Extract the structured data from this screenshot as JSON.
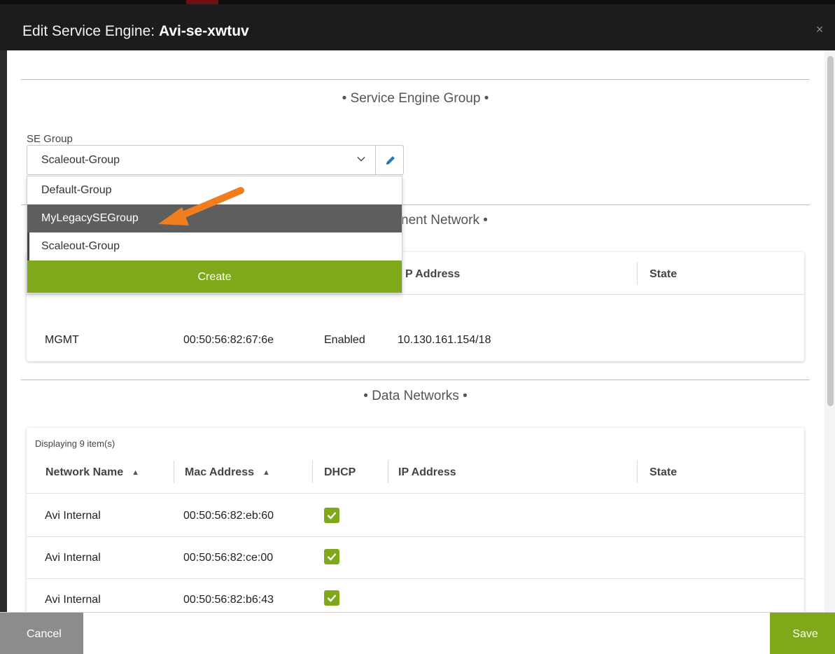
{
  "dialog": {
    "title_prefix": "Edit Service Engine: ",
    "title_name": "Avi-se-xwtuv",
    "close_glyph": "×"
  },
  "se_group_section": {
    "heading": "• Service Engine Group •",
    "field_label": "SE Group",
    "selected_value": "Scaleout-Group",
    "dropdown": {
      "options": [
        "Default-Group",
        "MyLegacySEGroup",
        "Scaleout-Group"
      ],
      "highlighted": "MyLegacySEGroup",
      "create_label": "Create"
    }
  },
  "mgmt_section": {
    "heading_visible": "nent Network •",
    "columns_visible": {
      "ip": "P Address",
      "state": "State"
    },
    "row": {
      "name": "MGMT",
      "mac": "00:50:56:82:67:6e",
      "dhcp": "Enabled",
      "ip": "10.130.161.154/18",
      "state": ""
    }
  },
  "data_section": {
    "heading": "• Data Networks •",
    "count_text": "Displaying 9 item(s)",
    "columns": {
      "network_name": "Network Name",
      "mac": "Mac Address",
      "dhcp": "DHCP",
      "ip": "IP Address",
      "state": "State"
    },
    "rows": [
      {
        "name": "Avi Internal",
        "mac": "00:50:56:82:eb:60",
        "dhcp": true
      },
      {
        "name": "Avi Internal",
        "mac": "00:50:56:82:ce:00",
        "dhcp": true
      },
      {
        "name": "Avi Internal",
        "mac": "00:50:56:82:b6:43",
        "dhcp": true
      }
    ]
  },
  "footer": {
    "cancel_label": "Cancel",
    "save_label": "Save"
  },
  "colors": {
    "accent_green": "#7fa91b",
    "highlight_gray": "#5e5e5e",
    "titlebar": "#1b1c1d",
    "annotation_arrow": "#f07d1e"
  },
  "icons": {
    "close": "close-icon",
    "chevron": "chevron-down-icon",
    "edit": "pencil-icon",
    "sort": "sort-icon",
    "check": "check-icon",
    "annotation": "arrow-annotation-icon"
  }
}
